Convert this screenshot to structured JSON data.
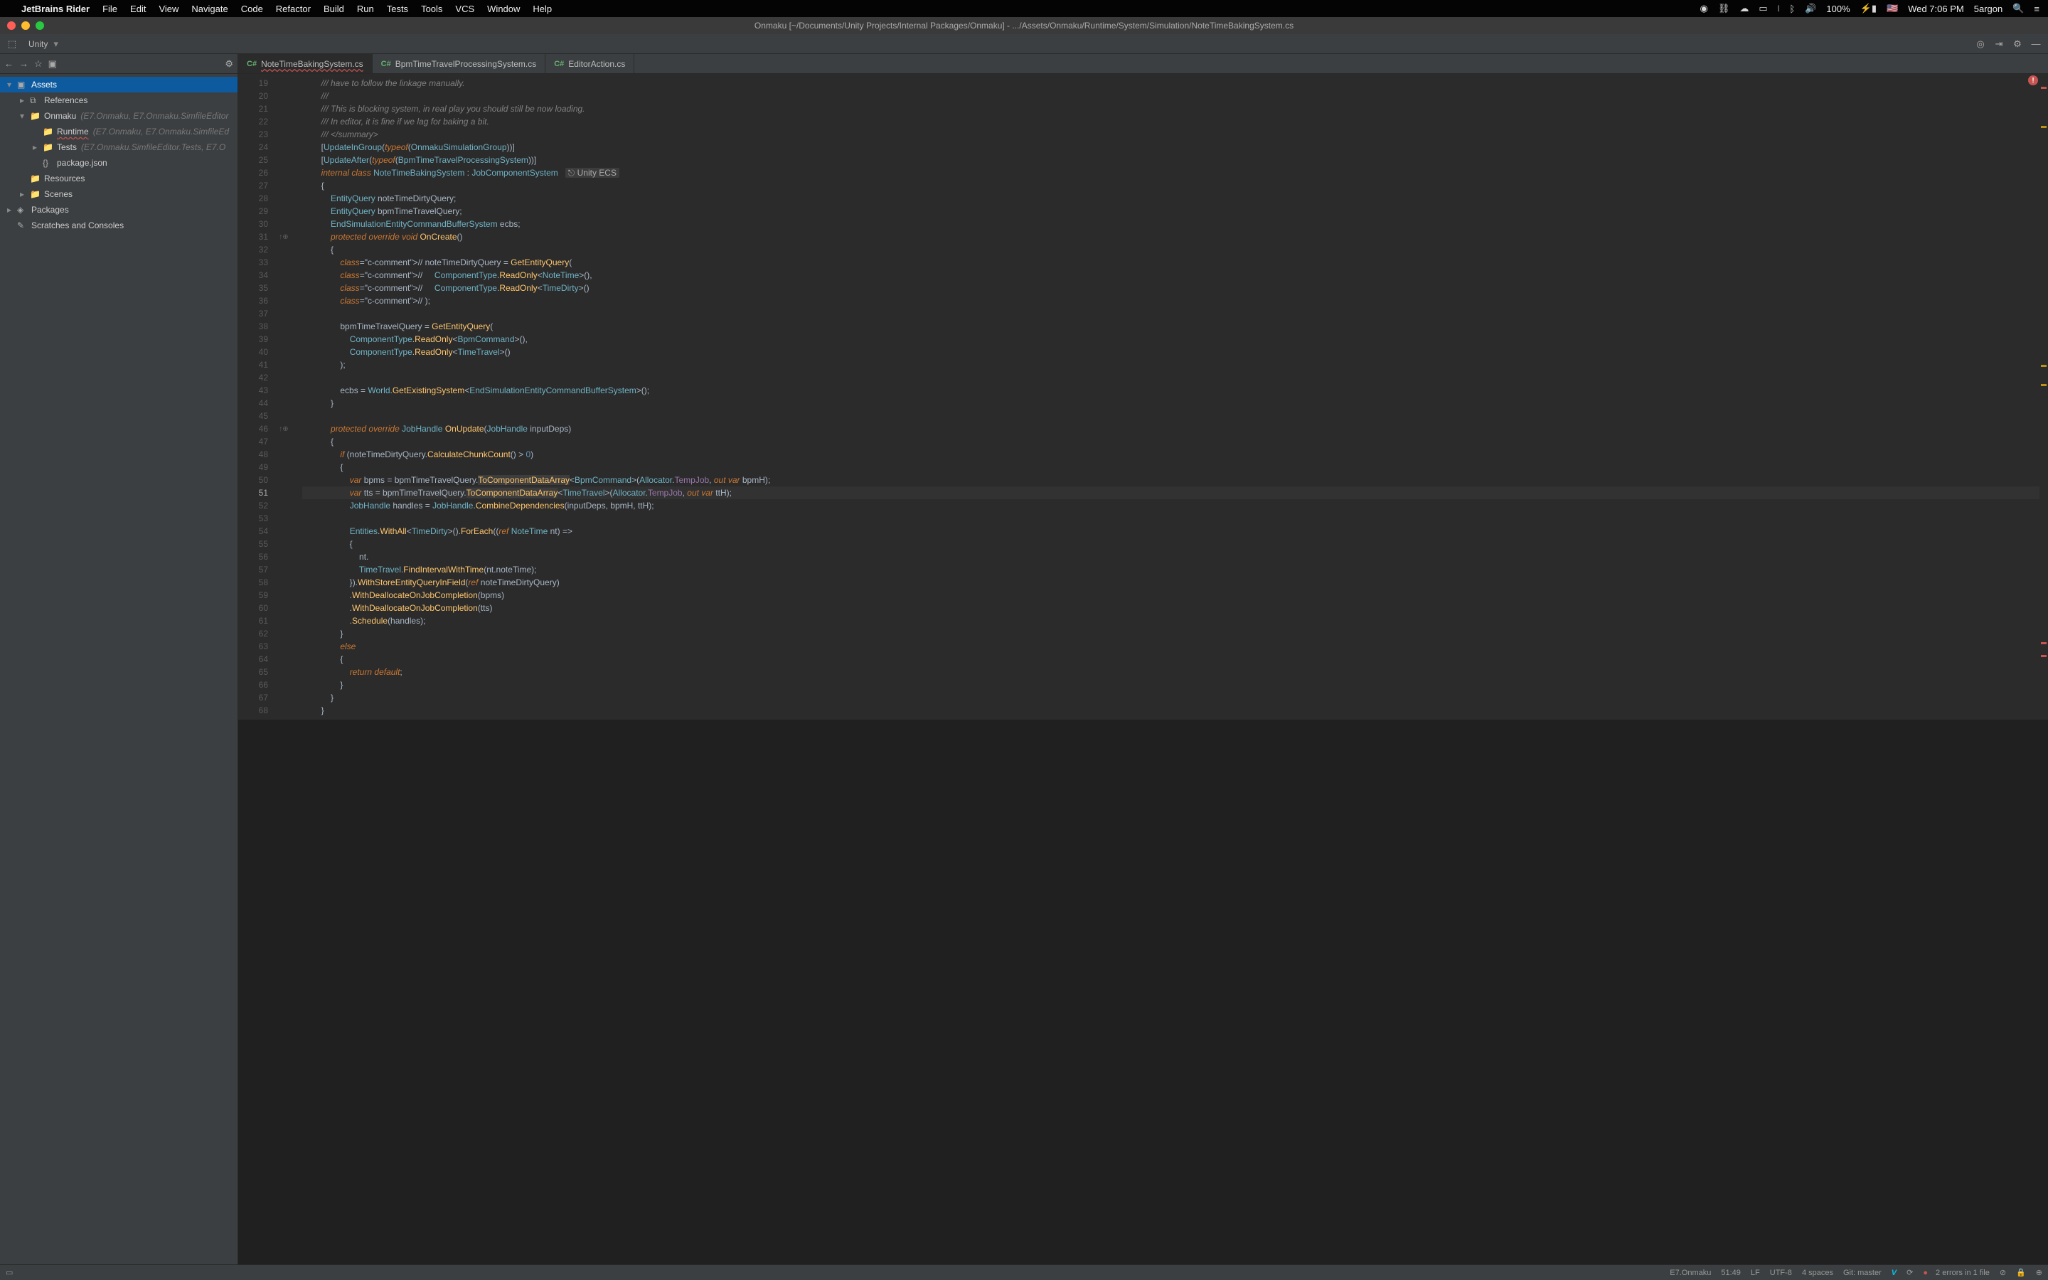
{
  "menubar": {
    "app": "JetBrains Rider",
    "items": [
      "File",
      "Edit",
      "View",
      "Navigate",
      "Code",
      "Refactor",
      "Build",
      "Run",
      "Tests",
      "Tools",
      "VCS",
      "Window",
      "Help"
    ],
    "battery": "100%",
    "clock": "Wed 7:06 PM",
    "user": "5argon"
  },
  "titlebar": {
    "title": "Onmaku [~/Documents/Unity Projects/Internal Packages/Onmaku] - .../Assets/Onmaku/Runtime/System/Simulation/NoteTimeBakingSystem.cs"
  },
  "nav_toolbar": {
    "scope": "Unity"
  },
  "tabs": [
    {
      "icon": "C#",
      "name": "NoteTimeBakingSystem.cs",
      "active": true
    },
    {
      "icon": "C#",
      "name": "BpmTimeTravelProcessingSystem.cs",
      "active": false
    },
    {
      "icon": "C#",
      "name": "EditorAction.cs",
      "active": false
    }
  ],
  "project": {
    "items": [
      {
        "pad": 6,
        "arrow": "▾",
        "icon": "module",
        "label": "Assets",
        "selected": true
      },
      {
        "pad": 24,
        "arrow": "▸",
        "icon": "ref",
        "label": "References"
      },
      {
        "pad": 24,
        "arrow": "▾",
        "icon": "folder",
        "label": "Onmaku",
        "hint": "(E7.Onmaku, E7.Onmaku.SimfileEditor"
      },
      {
        "pad": 42,
        "arrow": "",
        "icon": "folder",
        "label": "Runtime",
        "underline": true,
        "hint": "(E7.Onmaku, E7.Onmaku.SimfileEd"
      },
      {
        "pad": 42,
        "arrow": "▸",
        "icon": "folder",
        "label": "Tests",
        "hint": "(E7.Onmaku.SimfileEditor.Tests, E7.O"
      },
      {
        "pad": 42,
        "arrow": "",
        "icon": "json",
        "label": "package.json"
      },
      {
        "pad": 24,
        "arrow": "",
        "icon": "folder",
        "label": "Resources"
      },
      {
        "pad": 24,
        "arrow": "▸",
        "icon": "folder",
        "label": "Scenes"
      },
      {
        "pad": 6,
        "arrow": "▸",
        "icon": "pkg",
        "label": "Packages"
      },
      {
        "pad": 6,
        "arrow": "",
        "icon": "scratch",
        "label": "Scratches and Consoles"
      }
    ]
  },
  "code": {
    "first_line": 19,
    "caret_line": 51,
    "ecs_hint": "Unity ECS",
    "lines": [
      "        /// have to follow the linkage manually.",
      "        ///",
      "        /// This is blocking system, in real play you should still be now loading.",
      "        /// In editor, it is fine if we lag for baking a bit.",
      "        /// </summary>",
      "        [UpdateInGroup(typeof(OnmakuSimulationGroup))]",
      "        [UpdateAfter(typeof(BpmTimeTravelProcessingSystem))]",
      "        internal class NoteTimeBakingSystem : JobComponentSystem",
      "        {",
      "            EntityQuery noteTimeDirtyQuery;",
      "            EntityQuery bpmTimeTravelQuery;",
      "            EndSimulationEntityCommandBufferSystem ecbs;",
      "            protected override void OnCreate()",
      "            {",
      "                // noteTimeDirtyQuery = GetEntityQuery(",
      "                //     ComponentType.ReadOnly<NoteTime>(),",
      "                //     ComponentType.ReadOnly<TimeDirty>()",
      "                // );",
      "",
      "                bpmTimeTravelQuery = GetEntityQuery(",
      "                    ComponentType.ReadOnly<BpmCommand>(),",
      "                    ComponentType.ReadOnly<TimeTravel>()",
      "                );",
      "",
      "                ecbs = World.GetExistingSystem<EndSimulationEntityCommandBufferSystem>();",
      "            }",
      "",
      "            protected override JobHandle OnUpdate(JobHandle inputDeps)",
      "            {",
      "                if (noteTimeDirtyQuery.CalculateChunkCount() > 0)",
      "                {",
      "                    var bpms = bpmTimeTravelQuery.ToComponentDataArray<BpmCommand>(Allocator.TempJob, out var bpmH);",
      "                    var tts = bpmTimeTravelQuery.ToComponentDataArray<TimeTravel>(Allocator.TempJob, out var ttH);",
      "                    JobHandle handles = JobHandle.CombineDependencies(inputDeps, bpmH, ttH);",
      "",
      "                    Entities.WithAll<TimeDirty>().ForEach((ref NoteTime nt) =>",
      "                    {",
      "                        nt.",
      "                        TimeTravel.FindIntervalWithTime(nt.noteTime);",
      "                    }).WithStoreEntityQueryInField(ref noteTimeDirtyQuery)",
      "                    .WithDeallocateOnJobCompletion(bpms)",
      "                    .WithDeallocateOnJobCompletion(tts)",
      "                    .Schedule(handles);",
      "                }",
      "                else",
      "                {",
      "                    return default;",
      "                }",
      "            }",
      "        }"
    ],
    "markers": {
      "31": "↑⊕",
      "46": "↑⊕"
    }
  },
  "statusbar": {
    "context": "E7.Onmaku",
    "pos": "51:49",
    "eol": "LF",
    "encoding": "UTF-8",
    "indent": "4 spaces",
    "git": "Git: master",
    "errors": "2 errors in 1 file"
  }
}
